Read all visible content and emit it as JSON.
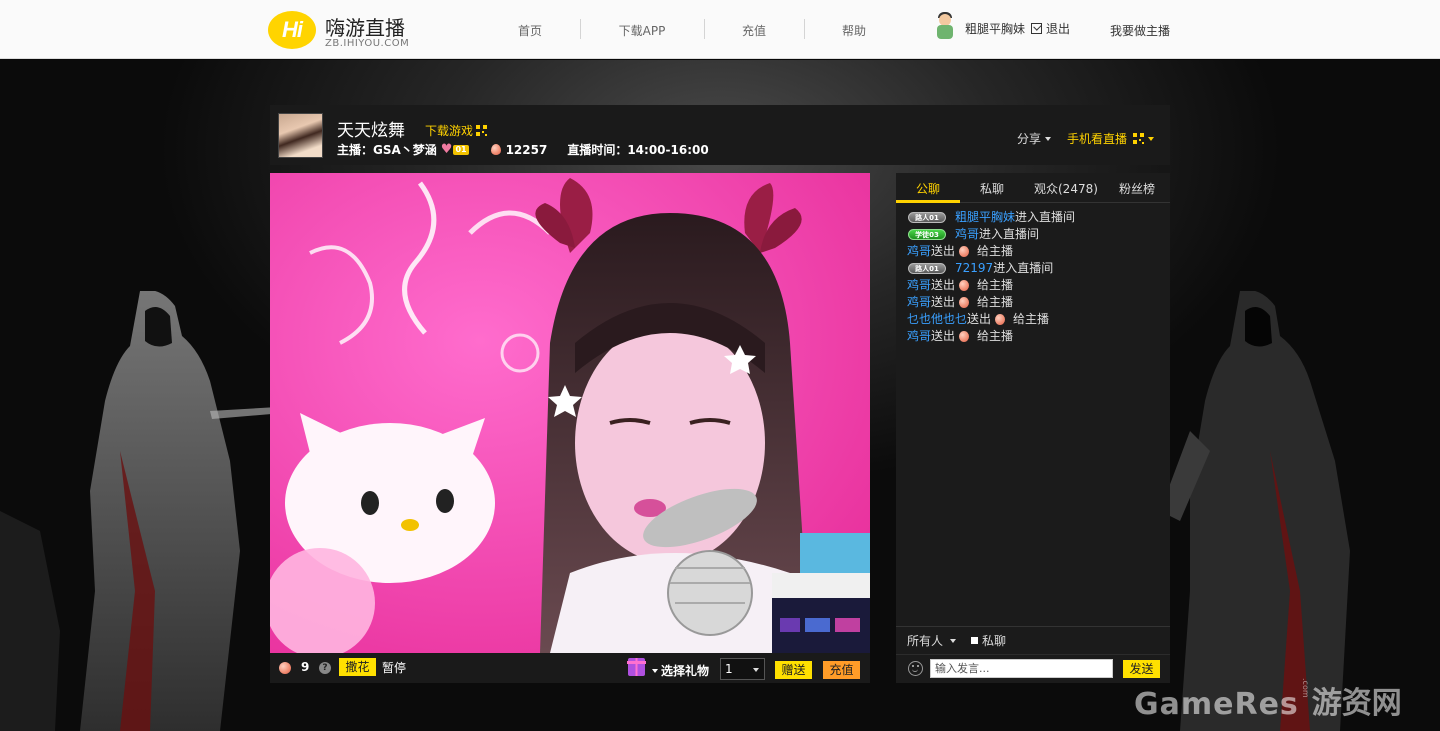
{
  "header": {
    "logo_badge": "Hi",
    "logo_title": "嗨游直播",
    "logo_sub": "ZB.IHIYOU.COM",
    "nav": [
      "首页",
      "下载APP",
      "充值",
      "帮助"
    ],
    "username": "粗腿平胸妹",
    "logout": "退出",
    "be_host": "我要做主播"
  },
  "room": {
    "title": "天天炫舞",
    "download_game": "下载游戏",
    "host_label": "主播：GSA丶梦涵",
    "host_level": "01",
    "peach_count": "12257",
    "broadcast_time": "直播时间：14:00-16:00",
    "share": "分享",
    "mobile_watch": "手机看直播"
  },
  "video_bar": {
    "flower_count": "9",
    "help": "?",
    "scatter_flowers": "撒花",
    "pause": "暂停",
    "choose_gift": "选择礼物",
    "quantity": "1",
    "give": "赠送",
    "recharge": "充值"
  },
  "chat": {
    "tabs": [
      "公聊",
      "私聊",
      "观众(2478)",
      "粉丝榜"
    ],
    "messages": [
      {
        "badge": "路人01",
        "user": "粗腿平胸妹",
        "text": " 进入直播间"
      },
      {
        "badge": "学徒03",
        "user": "鸡哥",
        "text": " 进入直播间"
      },
      {
        "user": "鸡哥",
        "text": "送出",
        "suffix": "给主播"
      },
      {
        "badge": "路人01",
        "user": "72197",
        "text": " 进入直播间"
      },
      {
        "user": "鸡哥",
        "text": "送出",
        "suffix": "给主播"
      },
      {
        "user": "鸡哥",
        "text": "送出",
        "suffix": "给主播"
      },
      {
        "user": "乜也他也乜",
        "text": "送出",
        "suffix": "给主播"
      },
      {
        "user": "鸡哥",
        "text": "送出",
        "suffix": "给主播"
      }
    ],
    "audience_select": "所有人",
    "private_chat": "私聊",
    "input_placeholder": "输入发言...",
    "send": "发送"
  },
  "watermark": {
    "en": "GameRes",
    "dot": ".com",
    "cn": "游资网"
  },
  "colors": {
    "accent": "#ffd200",
    "link": "#3aa0ff",
    "recharge": "#ff9c28"
  }
}
